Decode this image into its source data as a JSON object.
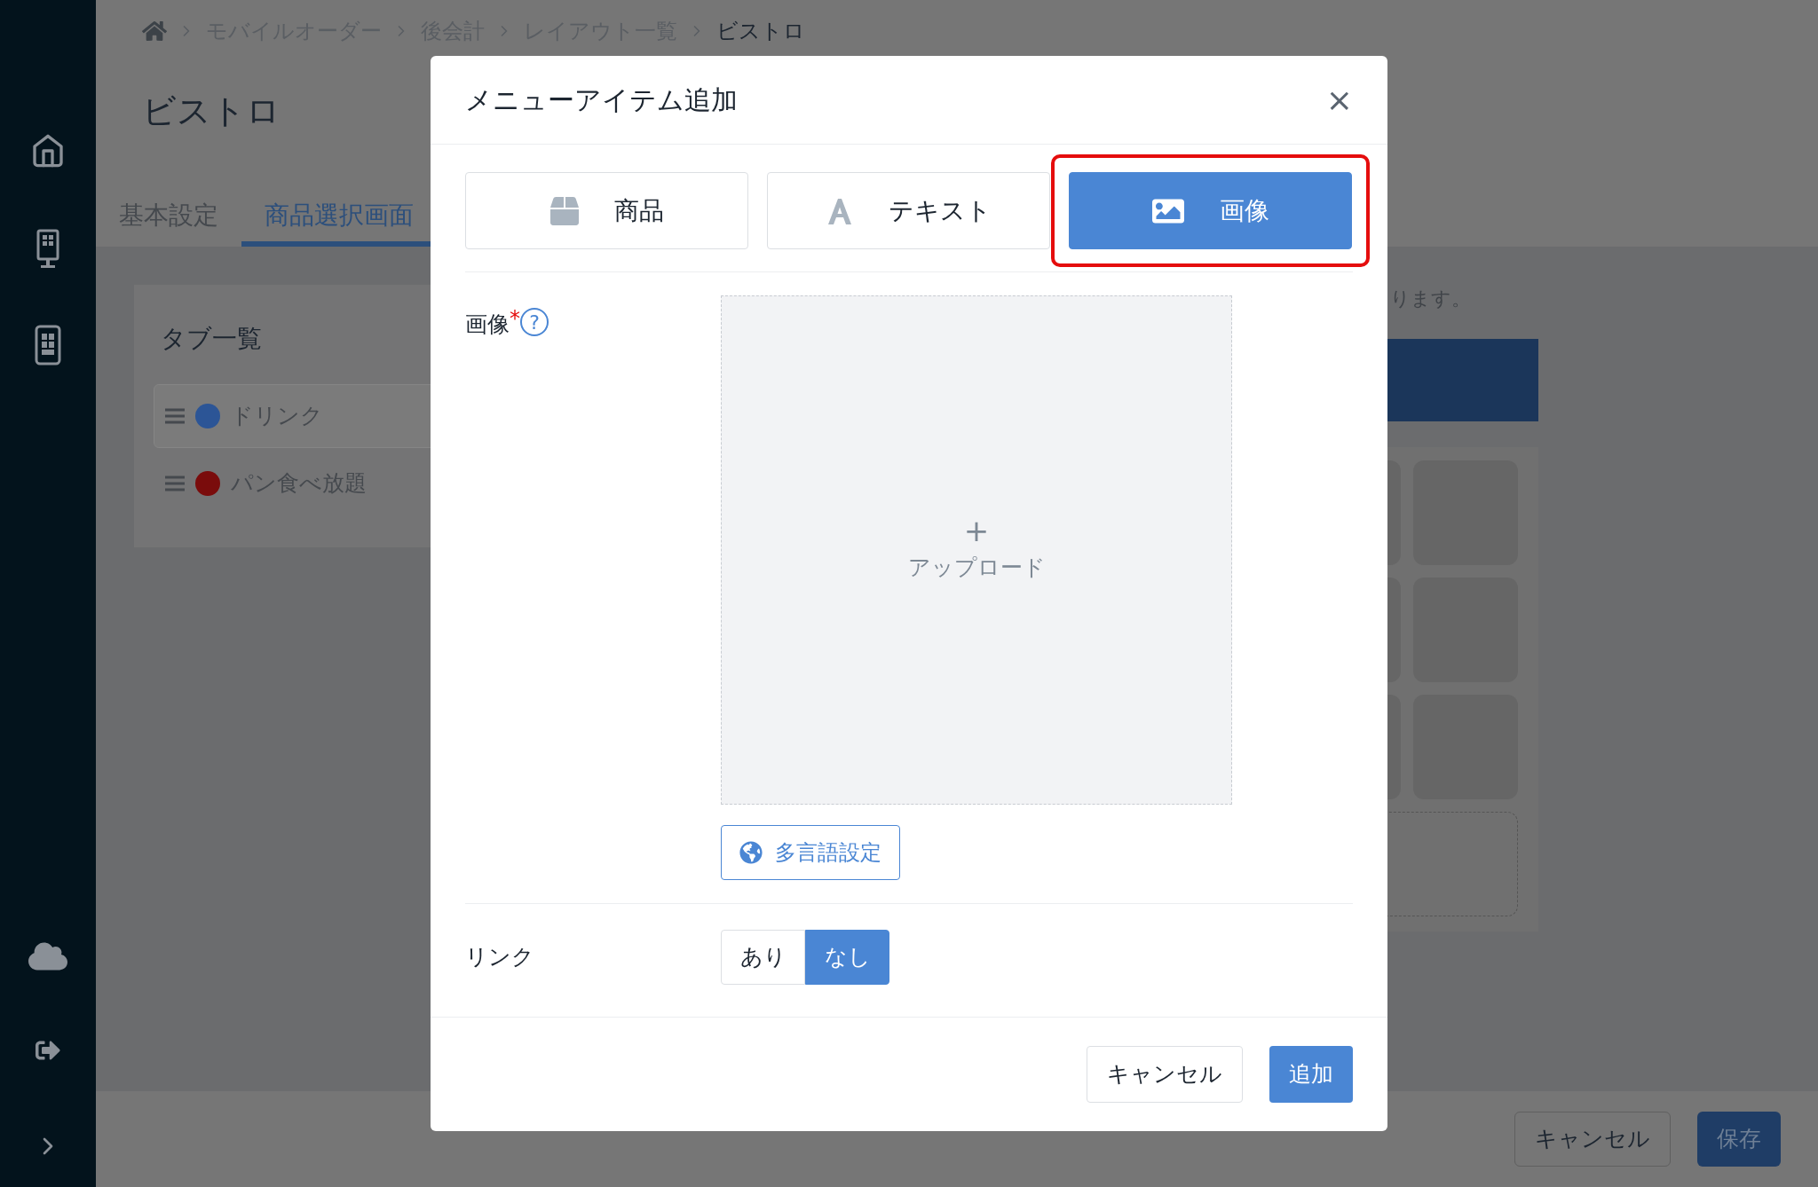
{
  "breadcrumb": [
    "モバイルオーダー",
    "後会計",
    "レイアウト一覧",
    "ビストロ"
  ],
  "page_title": "ビストロ",
  "page_tabs": [
    {
      "label": "基本設定",
      "selected": false
    },
    {
      "label": "商品選択画面",
      "selected": true
    }
  ],
  "tab_list": {
    "title": "タブ一覧",
    "items": [
      {
        "label": "ドリンク",
        "color": "#2c5596",
        "selected": true
      },
      {
        "label": "パン食べ放題",
        "color": "#7a0c0c",
        "selected": false
      }
    ]
  },
  "notice": "ります。",
  "footer_buttons": {
    "cancel": "キャンセル",
    "save": "保存"
  },
  "modal": {
    "title": "メニューアイテム追加",
    "close": "×",
    "type_tabs": [
      {
        "kind": "product",
        "label": "商品",
        "selected": false
      },
      {
        "kind": "text",
        "label": "テキスト",
        "selected": false
      },
      {
        "kind": "image",
        "label": "画像",
        "selected": true
      }
    ],
    "image_field": {
      "label": "画像",
      "required_mark": "*",
      "help": "?",
      "plus": "+",
      "upload": "アップロード",
      "language_button": "多言語設定"
    },
    "link": {
      "label": "リンク",
      "options": [
        {
          "label": "あり",
          "selected": false
        },
        {
          "label": "なし",
          "selected": true
        }
      ]
    },
    "buttons": {
      "cancel": "キャンセル",
      "add": "追加"
    }
  }
}
